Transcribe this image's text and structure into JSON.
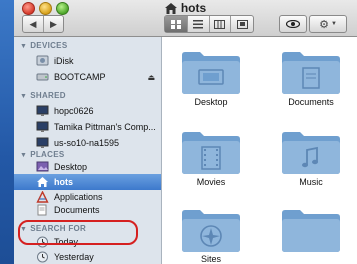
{
  "window": {
    "title": "hots"
  },
  "toolbar": {
    "back_icon": "back-arrow",
    "forward_icon": "forward-arrow",
    "view_modes": [
      "icon-view",
      "list-view",
      "column-view",
      "coverflow-view"
    ],
    "quicklook_icon": "eye-icon",
    "action_icon": "gear-icon"
  },
  "sidebar": {
    "sections": [
      {
        "title": "DEVICES",
        "items": [
          {
            "label": "iDisk",
            "icon": "idisk-icon"
          },
          {
            "label": "BOOTCAMP",
            "icon": "drive-icon",
            "eject": "⏏"
          }
        ]
      },
      {
        "title": "SHARED",
        "items": [
          {
            "label": "hopc0626",
            "icon": "monitor-icon"
          },
          {
            "label": "Tamika Pittman's Comp...",
            "icon": "monitor-icon"
          },
          {
            "label": "us-so10-na1595",
            "icon": "monitor-icon"
          }
        ]
      },
      {
        "title": "PLACES",
        "items": [
          {
            "label": "Desktop",
            "icon": "desktop-icon"
          },
          {
            "label": "hots",
            "icon": "home-icon",
            "selected": true
          },
          {
            "label": "Applications",
            "icon": "applications-icon"
          },
          {
            "label": "Documents",
            "icon": "documents-icon"
          }
        ]
      },
      {
        "title": "SEARCH FOR",
        "items": [
          {
            "label": "Today",
            "icon": "clock-icon"
          },
          {
            "label": "Yesterday",
            "icon": "clock-icon"
          }
        ]
      }
    ]
  },
  "content": {
    "folders": [
      {
        "label": "Desktop",
        "icon": "desktop-folder-icon"
      },
      {
        "label": "Documents",
        "icon": "documents-folder-icon"
      },
      {
        "label": "Movies",
        "icon": "movies-folder-icon"
      },
      {
        "label": "Music",
        "icon": "music-folder-icon"
      },
      {
        "label": "Sites",
        "icon": "sites-folder-icon"
      },
      {
        "label": "",
        "icon": "folder-icon"
      }
    ]
  },
  "colors": {
    "accent": "#3d79cc",
    "folder": "#8fb6dc",
    "highlight_ring": "#d52020"
  }
}
